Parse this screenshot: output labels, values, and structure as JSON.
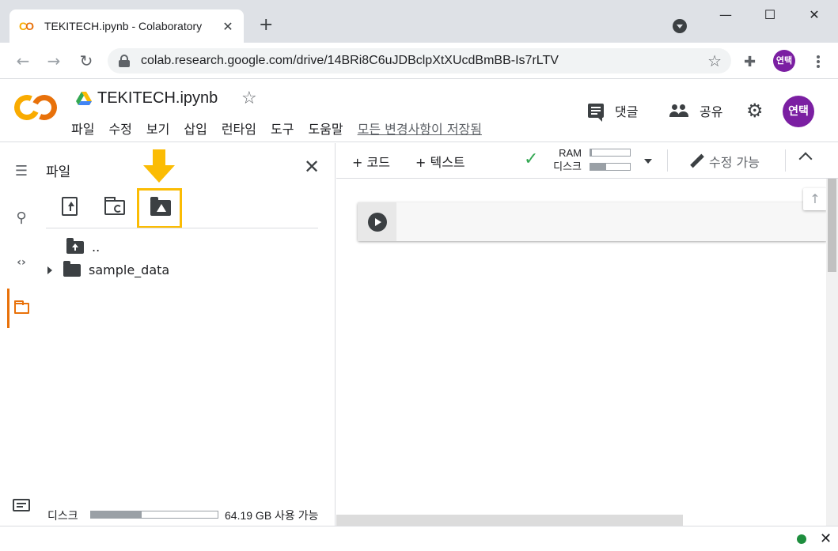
{
  "browser": {
    "tab_title": "TEKITECH.ipynb - Colaboratory",
    "favicon_text": "CO",
    "url": "colab.research.google.com/drive/14BRi8C6uJDBclpXtXUcdBmBB-Is7rLTV",
    "profile_initials": "연택"
  },
  "header": {
    "notebook_title": "TEKITECH.ipynb",
    "menu": [
      "파일",
      "수정",
      "보기",
      "삽입",
      "런타임",
      "도구",
      "도움말"
    ],
    "save_status": "모든 변경사항이 저장됨",
    "comment_label": "댓글",
    "share_label": "공유",
    "profile_initials": "연택"
  },
  "files_panel": {
    "title": "파일",
    "tree": [
      {
        "name": "..",
        "type": "parent"
      },
      {
        "name": "sample_data",
        "type": "folder",
        "collapsed": true
      }
    ],
    "disk_label": "디스크",
    "disk_used_fraction": 0.4,
    "disk_available": "64.19 GB 사용 가능",
    "highlight_color": "#fbbc04"
  },
  "notebook_toolbar": {
    "add_code": "+ 코드",
    "add_text": "+ 텍스트",
    "ram_label": "RAM",
    "disk_label": "디스크",
    "ram_used_fraction": 0.03,
    "disk_used_fraction": 0.4,
    "edit_mode": "수정 가능"
  },
  "colors": {
    "colab_orange": "#e8710a",
    "colab_yellow": "#f9ab00",
    "profile_purple": "#7b1fa2",
    "connected_green": "#34a853"
  }
}
